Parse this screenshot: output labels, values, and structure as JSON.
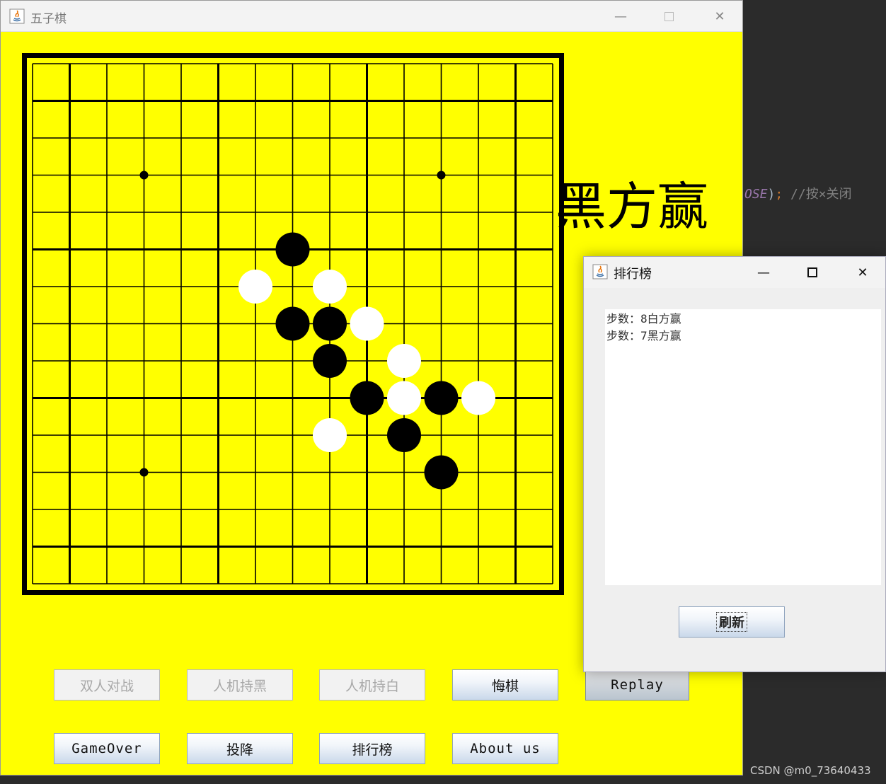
{
  "main_window": {
    "title": "五子棋",
    "result_text": "黑方赢",
    "buttons_row1": [
      {
        "label": "双人对战",
        "enabled": false
      },
      {
        "label": "人机持黑",
        "enabled": false
      },
      {
        "label": "人机持白",
        "enabled": false
      },
      {
        "label": "悔棋",
        "enabled": true
      }
    ],
    "buttons_row2": [
      {
        "label": "GameOver",
        "enabled": true
      },
      {
        "label": "投降",
        "enabled": true
      },
      {
        "label": "排行榜",
        "enabled": true
      },
      {
        "label": "About us",
        "enabled": true
      }
    ],
    "replay_label": "Replay"
  },
  "board": {
    "grid_size": 15,
    "board_color": "#ffff00",
    "star_points": [
      [
        3,
        3
      ],
      [
        11,
        3
      ],
      [
        3,
        11
      ]
    ],
    "stones": [
      {
        "col": 7,
        "row": 5,
        "color": "black"
      },
      {
        "col": 6,
        "row": 6,
        "color": "white"
      },
      {
        "col": 8,
        "row": 6,
        "color": "white"
      },
      {
        "col": 7,
        "row": 7,
        "color": "black"
      },
      {
        "col": 8,
        "row": 7,
        "color": "black"
      },
      {
        "col": 9,
        "row": 7,
        "color": "white"
      },
      {
        "col": 8,
        "row": 8,
        "color": "black"
      },
      {
        "col": 10,
        "row": 8,
        "color": "white"
      },
      {
        "col": 9,
        "row": 9,
        "color": "black"
      },
      {
        "col": 10,
        "row": 9,
        "color": "white"
      },
      {
        "col": 11,
        "row": 9,
        "color": "black"
      },
      {
        "col": 12,
        "row": 9,
        "color": "white"
      },
      {
        "col": 8,
        "row": 10,
        "color": "white"
      },
      {
        "col": 10,
        "row": 10,
        "color": "black"
      },
      {
        "col": 11,
        "row": 11,
        "color": "black"
      }
    ]
  },
  "dialog": {
    "title": "排行榜",
    "records": [
      "步数：8白方赢",
      "步数：7黑方赢"
    ],
    "refresh_label": "刷新"
  },
  "background_code": {
    "part_a": "OSE",
    "part_b": ")",
    "part_c": ";",
    "comment": "//按×关闭"
  },
  "watermark": "CSDN @m0_73640433"
}
